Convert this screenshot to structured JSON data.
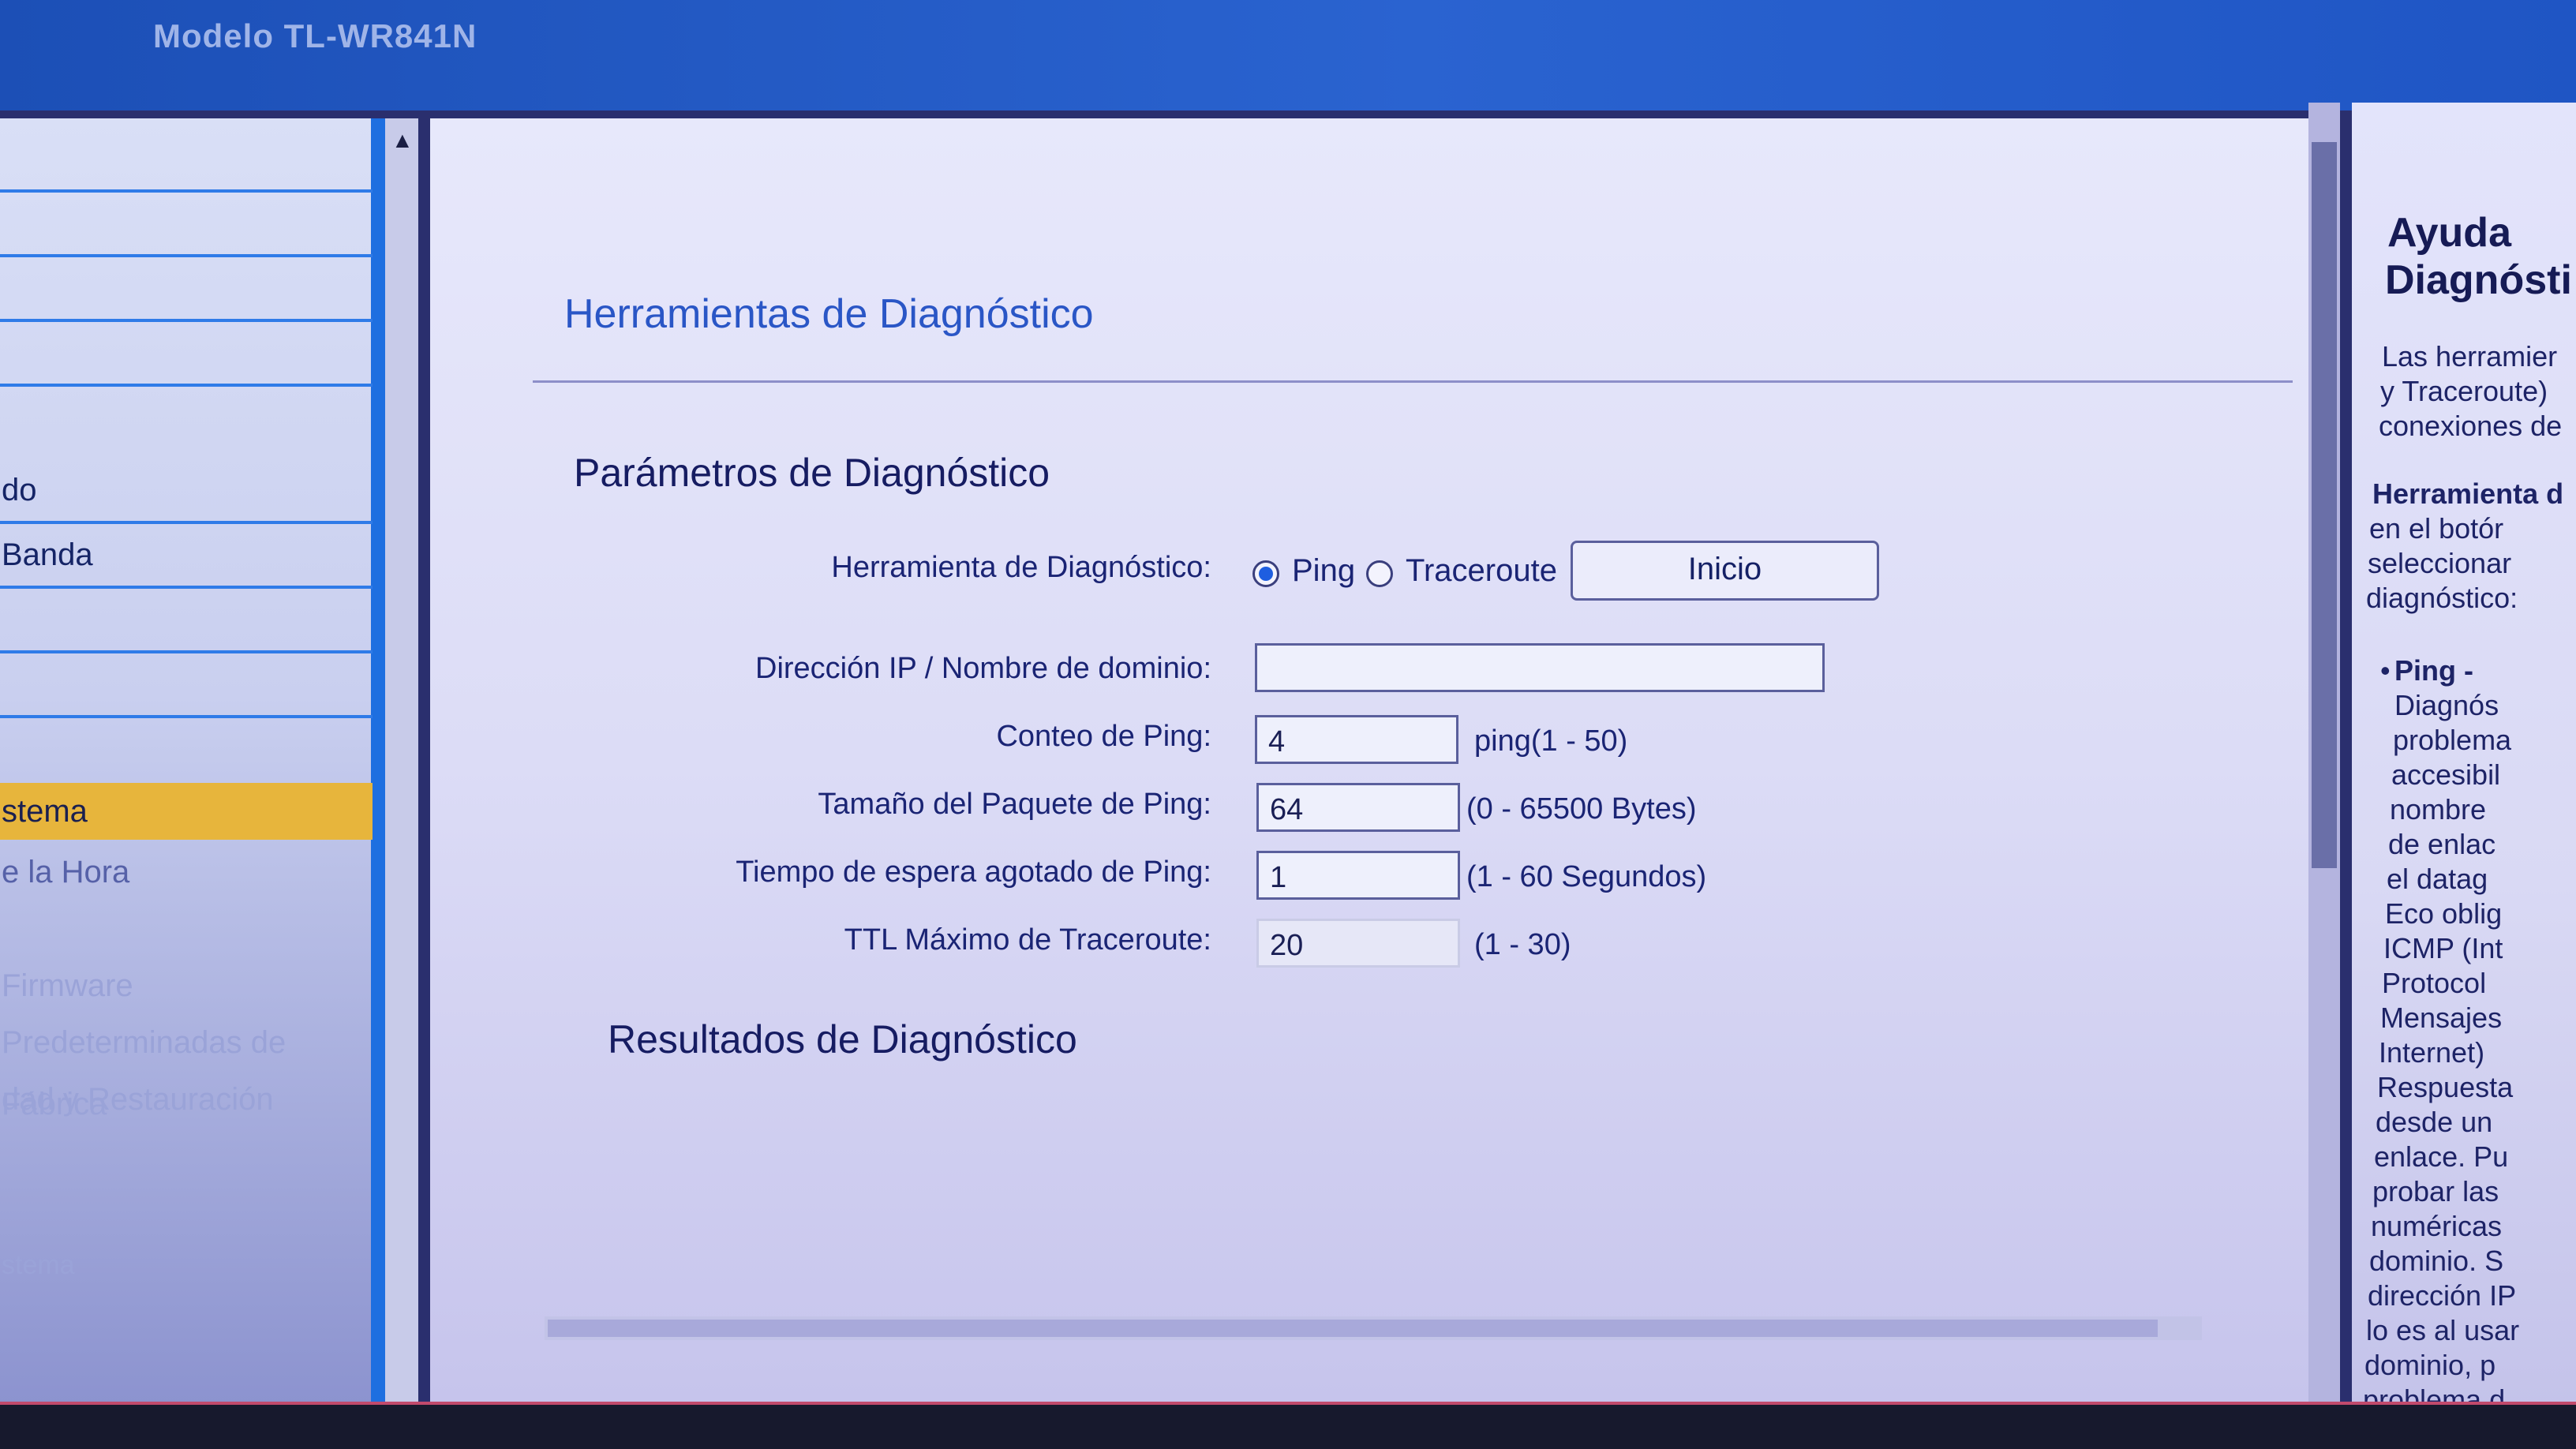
{
  "header": {
    "model": "Modelo TL-WR841N"
  },
  "sidebar": {
    "items": [
      {
        "label": ""
      },
      {
        "label": ""
      },
      {
        "label": ""
      },
      {
        "label": ""
      },
      {
        "label": "do"
      },
      {
        "label": "Banda"
      },
      {
        "label": ""
      },
      {
        "label": ""
      },
      {
        "label": "stema",
        "active": true
      },
      {
        "label": "e la Hora"
      },
      {
        "label": "Firmware"
      },
      {
        "label": "Predeterminadas de Fábrica"
      },
      {
        "label": "dad y Restauración"
      },
      {
        "label": "stema"
      }
    ]
  },
  "main": {
    "title": "Herramientas de Diagnóstico",
    "params_title": "Parámetros de Diagnóstico",
    "tool_label": "Herramienta de Diagnóstico:",
    "ping_option": "Ping",
    "traceroute_option": "Traceroute",
    "selected_tool": "Ping",
    "start_button": "Inicio",
    "ip_label": "Dirección IP / Nombre de dominio:",
    "ip_value": "",
    "ping_count_label": "Conteo de Ping:",
    "ping_count_value": "4",
    "ping_count_hint": "ping(1 - 50)",
    "packet_size_label": "Tamaño del Paquete de Ping:",
    "packet_size_value": "64",
    "packet_size_hint": "(0 - 65500 Bytes)",
    "timeout_label": "Tiempo de espera agotado de Ping:",
    "timeout_value": "1",
    "timeout_hint": "(1 - 60 Segundos)",
    "ttl_label": "TTL Máximo de Traceroute:",
    "ttl_value": "20",
    "ttl_hint": "(1 - 30)",
    "results_title": "Resultados de Diagnóstico"
  },
  "help": {
    "title1": "Ayuda",
    "title2": "Diagnósti",
    "intro": [
      "Las herramier",
      "y Traceroute)",
      "conexiones de"
    ],
    "tool_heading": "Herramienta d",
    "tool_lines": [
      "en el botór",
      "seleccionar",
      "diagnóstico:"
    ],
    "ping_bullet": "Ping -",
    "ping_lines": [
      "Diagnós",
      "problema",
      "accesibil",
      "nombre",
      "de enlac",
      "el datag",
      "Eco oblig",
      "ICMP (Int",
      "Protocol",
      "Mensajes",
      "Internet)",
      "Respuesta",
      "desde un",
      "enlace. Pu",
      "probar las",
      "numéricas",
      "dominio. S",
      "dirección IP",
      "lo es al usar",
      "dominio, p",
      "problema d"
    ]
  }
}
